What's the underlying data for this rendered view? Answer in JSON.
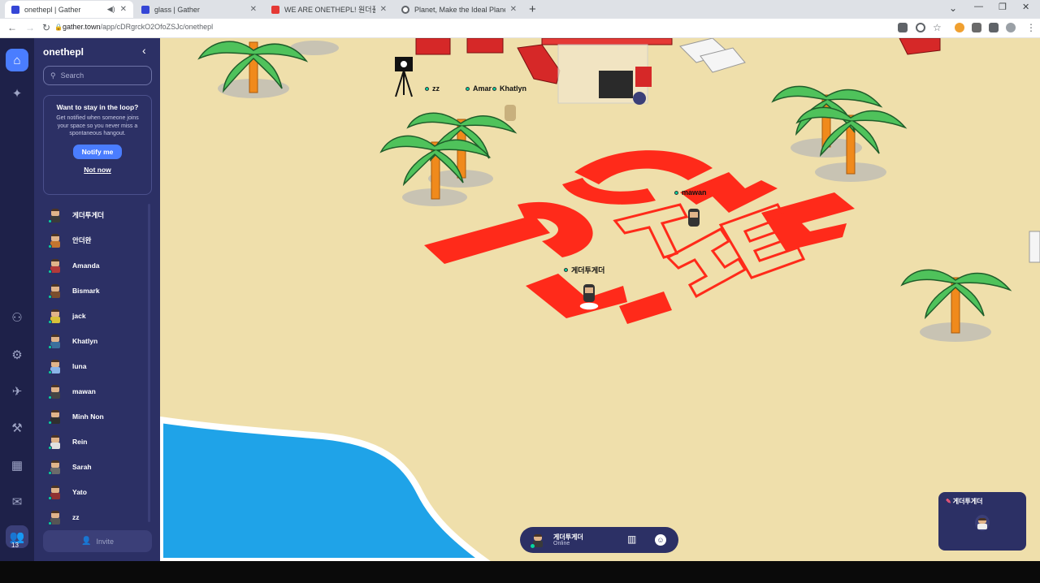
{
  "browser": {
    "tabs": [
      {
        "title": "onethepl | Gather",
        "favicon_color": "#3546d6",
        "active": true
      },
      {
        "title": "glass | Gather",
        "favicon_color": "#3546d6",
        "active": false
      },
      {
        "title": "WE ARE ONETHEPL! 원더풀 피",
        "favicon_color": "#e53935",
        "active": false
      },
      {
        "title": "Planet, Make the Ideal Planet",
        "favicon_color": "#5f6368",
        "active": false
      }
    ],
    "new_tab": "+",
    "url_host": "gather.town",
    "url_path": "/app/cDRgrckO2OfoZSJc/onethepl",
    "window_controls": [
      "⌄",
      "—",
      "❐",
      "✕"
    ]
  },
  "rail": {
    "online_count": "13"
  },
  "panel": {
    "space_name": "onethepl",
    "search_placeholder": "Search",
    "loop": {
      "title": "Want to stay in the loop?",
      "body": "Get notified when someone joins your space so you never miss a spontaneous hangout.",
      "notify_label": "Notify me",
      "not_now_label": "Not now"
    },
    "members": [
      {
        "name": "게더투게더",
        "shirt": "#3a3a3a"
      },
      {
        "name": "안더완",
        "shirt": "#c2752f"
      },
      {
        "name": "Amanda",
        "shirt": "#b23a3a"
      },
      {
        "name": "Bismark",
        "shirt": "#7a4e2d"
      },
      {
        "name": "jack",
        "shirt": "#d8c23a"
      },
      {
        "name": "Khatlyn",
        "shirt": "#3b6f9c"
      },
      {
        "name": "luna",
        "shirt": "#8ab4e8"
      },
      {
        "name": "mawan",
        "shirt": "#444444"
      },
      {
        "name": "Minh Non",
        "shirt": "#2f2f2f"
      },
      {
        "name": "Rein",
        "shirt": "#e0e0e0"
      },
      {
        "name": "Sarah",
        "shirt": "#6b6b6b"
      },
      {
        "name": "Yato",
        "shirt": "#8f3232"
      },
      {
        "name": "zz",
        "shirt": "#555555"
      }
    ],
    "invite_label": "Invite"
  },
  "map": {
    "player_labels": [
      {
        "name": "zz"
      },
      {
        "name": "Amar"
      },
      {
        "name": "Khatlyn"
      },
      {
        "name": "mawan"
      },
      {
        "name": "게더투게더"
      }
    ],
    "colors": {
      "sand": "#efdfab",
      "sea": "#1fa3e8",
      "logo_red": "#ff2a1a",
      "palm_trunk": "#f08a1c",
      "palm_leaf": "#4fc25b"
    }
  },
  "dock": {
    "name": "게더투게더",
    "status": "Online"
  },
  "video": {
    "name": "게더투게더"
  }
}
